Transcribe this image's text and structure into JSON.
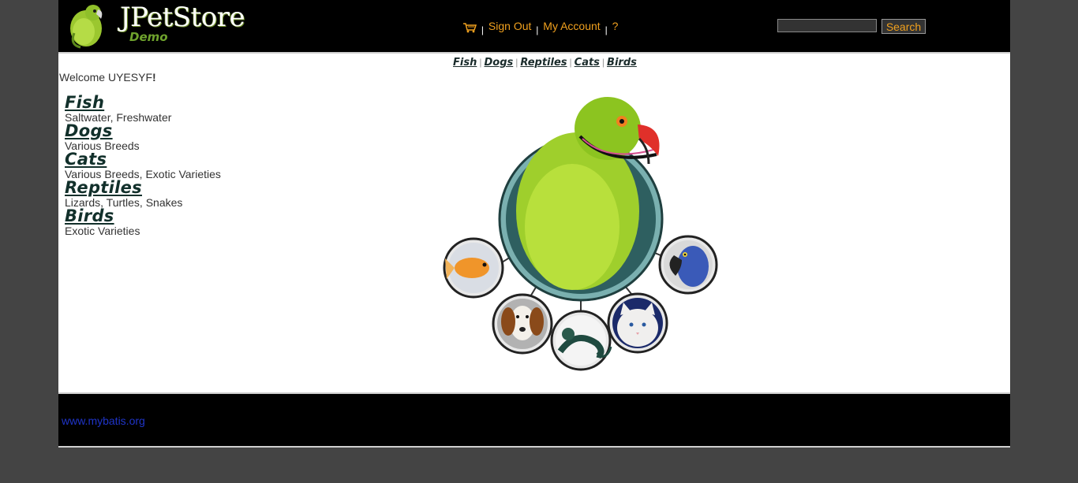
{
  "header": {
    "logo_text": "JPetStore",
    "logo_subtitle": "Demo",
    "menu": {
      "sign_out": "Sign Out",
      "my_account": "My Account",
      "help": "?",
      "separator": "|"
    },
    "search": {
      "value": "",
      "button_label": "Search"
    }
  },
  "quicklinks": [
    "Fish",
    "Dogs",
    "Reptiles",
    "Cats",
    "Birds"
  ],
  "welcome": {
    "prefix": "Welcome UYESYF",
    "suffix": "!"
  },
  "sidebar": {
    "categories": [
      {
        "title": "Fish",
        "description": "Saltwater, Freshwater"
      },
      {
        "title": "Dogs",
        "description": "Various Breeds"
      },
      {
        "title": "Cats",
        "description": "Various Breeds, Exotic Varieties"
      },
      {
        "title": "Reptiles",
        "description": "Lizards, Turtles, Snakes"
      },
      {
        "title": "Birds",
        "description": "Exotic Varieties"
      }
    ]
  },
  "footer": {
    "link_text": "www.mybatis.org"
  },
  "colors": {
    "background": "#444444",
    "header": "#000000",
    "menu_link": "#f0a01e",
    "footer_link": "#1f34c8",
    "category_title": "#12302b"
  }
}
